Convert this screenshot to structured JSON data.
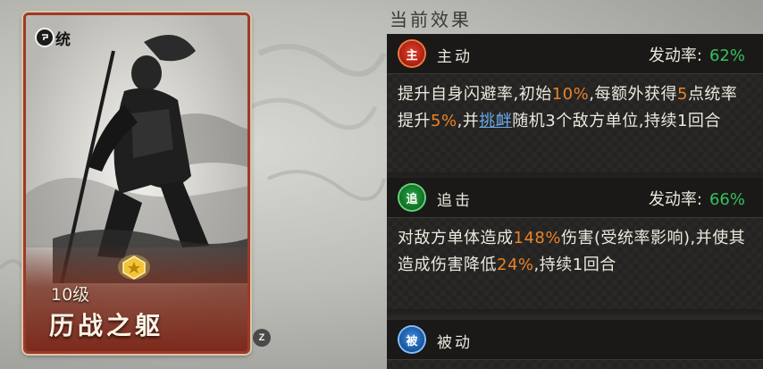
{
  "card": {
    "badge_text": "统",
    "level": "10级",
    "name": "历战之躯",
    "colors": {
      "frame": "#9b3a2c",
      "bottom": "#7d2a1c"
    }
  },
  "shortcut_key": "Z",
  "section_title": "当前效果",
  "effects": [
    {
      "tag": "主",
      "label": "主动",
      "rate_label": "发动率:",
      "rate_value": "62%",
      "desc": {
        "t1": "提升自身闪避率,初始",
        "h1": "10%",
        "t2": ",每额外获得",
        "h2": "5",
        "t3": "点统率提升",
        "h3": "5%",
        "t4": ",并",
        "link": "挑衅",
        "t5": "随机3个敌方单位,持续1回合"
      }
    },
    {
      "tag": "追",
      "label": "追击",
      "rate_label": "发动率:",
      "rate_value": "66%",
      "desc": {
        "t1": "对敌方单体造成",
        "h1": "148%",
        "t2": "伤害(受统率影响),并使其造成伤害降低",
        "h2": "24%",
        "t3": ",持续1回合"
      }
    },
    {
      "tag": "被",
      "label": "被动"
    }
  ],
  "colors": {
    "highlight": "#e9832a",
    "link": "#6aa6e6",
    "rate": "#38c05a"
  }
}
